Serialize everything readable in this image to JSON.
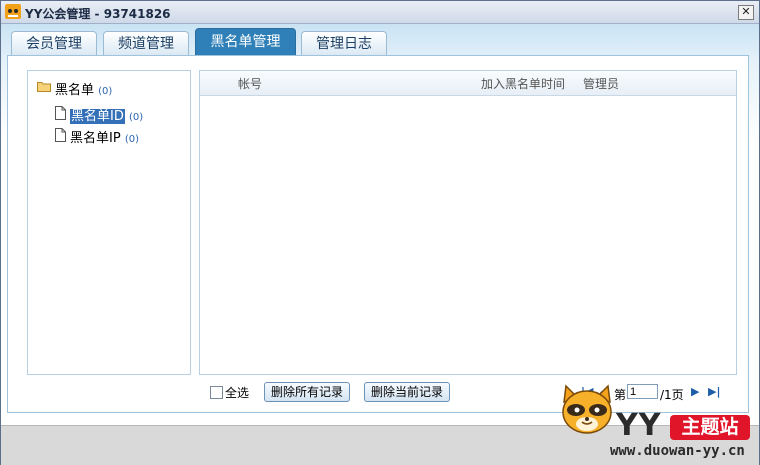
{
  "window": {
    "title": "YY公会管理 - 93741826",
    "close_label": "✕"
  },
  "tabs": [
    {
      "label": "会员管理",
      "active": false
    },
    {
      "label": "频道管理",
      "active": false
    },
    {
      "label": "黑名单管理",
      "active": true
    },
    {
      "label": "管理日志",
      "active": false
    }
  ],
  "tree": {
    "root": {
      "label": "黑名单",
      "count": "(0)",
      "icon": "folder-icon"
    },
    "children": [
      {
        "label": "黑名单ID",
        "count": "(0)",
        "selected": true,
        "icon": "document-icon"
      },
      {
        "label": "黑名单IP",
        "count": "(0)",
        "selected": false,
        "icon": "document-icon"
      }
    ]
  },
  "list": {
    "columns": [
      "帐号",
      "加入黑名单时间",
      "管理员"
    ],
    "rows": []
  },
  "toolbar": {
    "select_all_label": "全选",
    "select_all_checked": false,
    "delete_all_label": "删除所有记录",
    "delete_current_label": "删除当前记录"
  },
  "pager": {
    "first": "|◀",
    "prev": "◀",
    "page_prefix": "第",
    "current_page": "1",
    "total": "/1页",
    "next": "▶",
    "last": "▶|"
  },
  "watermark": {
    "brand": "YY",
    "badge": "主题站",
    "url": "www.duowan-yy.cn"
  },
  "colors": {
    "active_tab": "#2f80b8",
    "accent_blue": "#2b64b0",
    "badge_red": "#e0152a"
  }
}
